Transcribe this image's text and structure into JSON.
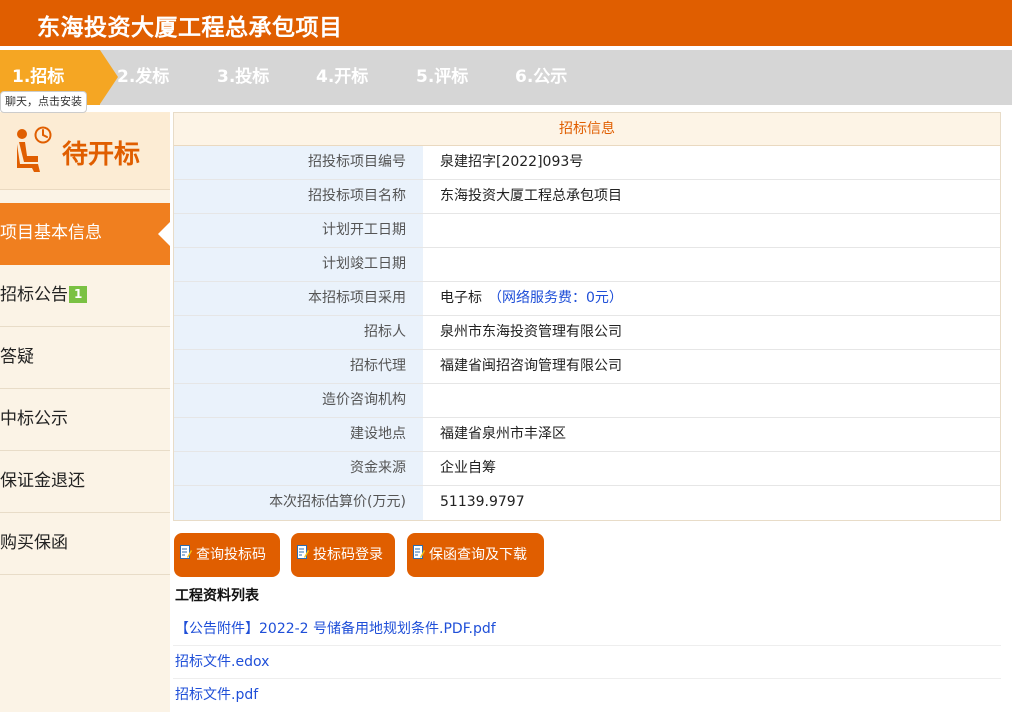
{
  "header": {
    "title": "东海投资大厦工程总承包项目"
  },
  "steps": [
    {
      "label": "1.招标",
      "active": true
    },
    {
      "label": "2.发标"
    },
    {
      "label": "3.投标"
    },
    {
      "label": "4.开标"
    },
    {
      "label": "5.评标"
    },
    {
      "label": "6.公示"
    }
  ],
  "tooltip": "聊天，点击安装",
  "sidebar": {
    "status": "待开标",
    "items": [
      {
        "label": "项目基本信息",
        "active": true
      },
      {
        "label": "招标公告",
        "badge": "1"
      },
      {
        "label": "答疑"
      },
      {
        "label": "中标公示"
      },
      {
        "label": "保证金退还"
      },
      {
        "label": "购买保函"
      }
    ]
  },
  "info": {
    "title": "招标信息",
    "rows": [
      {
        "label": "招投标项目编号",
        "value": "泉建招字[2022]093号"
      },
      {
        "label": "招投标项目名称",
        "value": "东海投资大厦工程总承包项目"
      },
      {
        "label": "计划开工日期",
        "value": ""
      },
      {
        "label": "计划竣工日期",
        "value": ""
      },
      {
        "label": "本招标项目采用",
        "value": "电子标",
        "note": "（网络服务费：0元）"
      },
      {
        "label": "招标人",
        "value": "泉州市东海投资管理有限公司"
      },
      {
        "label": "招标代理",
        "value": "福建省闽招咨询管理有限公司"
      },
      {
        "label": "造价咨询机构",
        "value": ""
      },
      {
        "label": "建设地点",
        "value": "福建省泉州市丰泽区"
      },
      {
        "label": "资金来源",
        "value": "企业自筹"
      },
      {
        "label": "本次招标估算价(万元)",
        "value": "51139.9797"
      }
    ]
  },
  "buttons": {
    "query_code": "查询投标码",
    "code_login": "投标码登录",
    "guarantee": "保函查询及下载"
  },
  "files": {
    "title": "工程资料列表",
    "items": [
      "【公告附件】2022-2 号储备用地规划条件.PDF.pdf",
      "招标文件.edox",
      "招标文件.pdf"
    ]
  },
  "colors": {
    "brand": "#e05e00",
    "step_active": "#f5a623",
    "sidebar_active": "#f07f1f",
    "link": "#1f4fd8"
  }
}
